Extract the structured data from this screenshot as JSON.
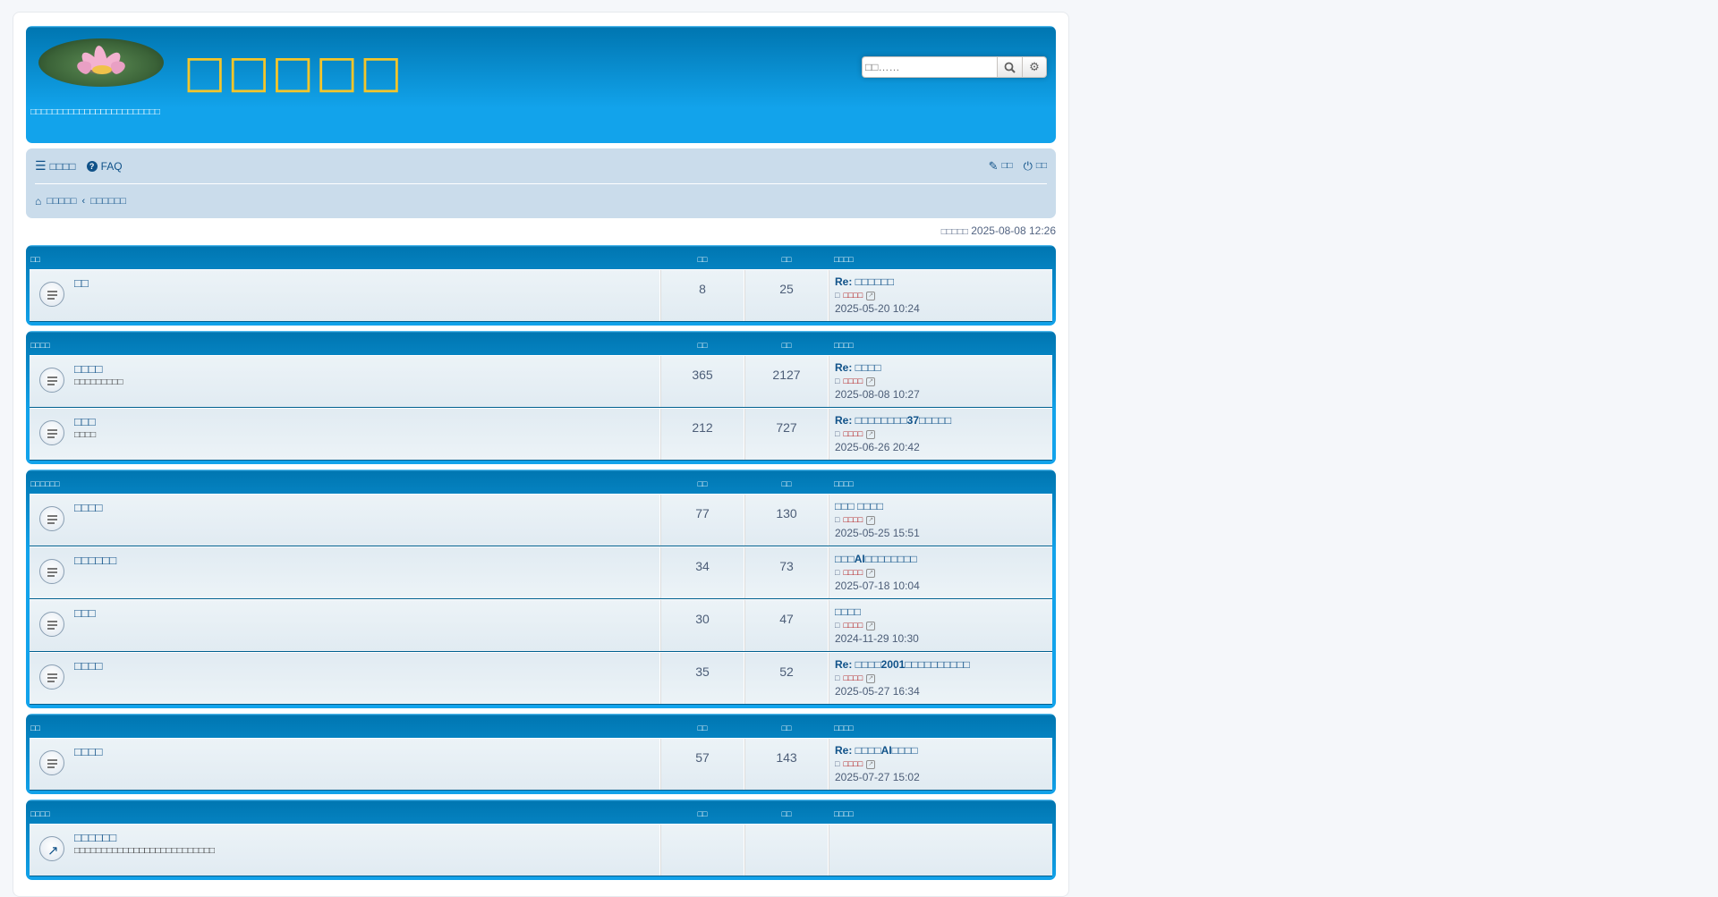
{
  "header": {
    "site_name": "□□□□□",
    "site_desc": "□□□□□□□□□□□□□□□□□□□□□□□□",
    "search_placeholder": "□□……"
  },
  "nav": {
    "quick_links": "□□□□",
    "faq": "FAQ",
    "register": "□□",
    "login": "□□",
    "crumb_home": "□□□□□",
    "crumb_index": "□□□□□□"
  },
  "time_info": {
    "label": "□□□□□",
    "value": "2025-08-08 12:26"
  },
  "categories": [
    {
      "name": "□□",
      "topics_label": "□□",
      "posts_label": "□□",
      "last_label": "□□□□",
      "forums": [
        {
          "title": "□□",
          "desc": "",
          "topics": "8",
          "posts": "25",
          "last_title": "Re: □□□□□□",
          "by": "□",
          "user": "□□□□",
          "time": "2025-05-20 10:24"
        }
      ]
    },
    {
      "name": "□□□□",
      "topics_label": "□□",
      "posts_label": "□□",
      "last_label": "□□□□",
      "forums": [
        {
          "title": "□□□□",
          "desc": "□□□□□□□□□",
          "topics": "365",
          "posts": "2127",
          "last_title": "Re: □□□□",
          "by": "□",
          "user": "□□□□",
          "time": "2025-08-08 10:27"
        },
        {
          "title": "□□□",
          "desc": "□□□□",
          "topics": "212",
          "posts": "727",
          "last_title": "Re: □□□□□□□□37□□□□□",
          "by": "□",
          "user": "□□□□",
          "time": "2025-06-26 20:42"
        }
      ]
    },
    {
      "name": "□□□□□□",
      "topics_label": "□□",
      "posts_label": "□□",
      "last_label": "□□□□",
      "forums": [
        {
          "title": "□□□□",
          "desc": "",
          "topics": "77",
          "posts": "130",
          "last_title": "□□□ □□□□",
          "by": "□",
          "user": "□□□□",
          "time": "2025-05-25 15:51"
        },
        {
          "title": "□□□□□□",
          "desc": "",
          "topics": "34",
          "posts": "73",
          "last_title": "□□□AI□□□□□□□□",
          "by": "□",
          "user": "□□□□",
          "time": "2025-07-18 10:04"
        },
        {
          "title": "□□□",
          "desc": "",
          "topics": "30",
          "posts": "47",
          "last_title": "□□□□",
          "by": "□",
          "user": "□□□□",
          "time": "2024-11-29 10:30"
        },
        {
          "title": "□□□□",
          "desc": "",
          "topics": "35",
          "posts": "52",
          "last_title": "Re: □□□□2001□□□□□□□□□□",
          "by": "□",
          "user": "□□□□",
          "time": "2025-05-27 16:34"
        }
      ]
    },
    {
      "name": "□□",
      "topics_label": "□□",
      "posts_label": "□□",
      "last_label": "□□□□",
      "forums": [
        {
          "title": "□□□□",
          "desc": "",
          "topics": "57",
          "posts": "143",
          "last_title": "Re: □□□□AI□□□□",
          "by": "□",
          "user": "□□□□",
          "time": "2025-07-27 15:02"
        }
      ]
    },
    {
      "name": "□□□□",
      "topics_label": "□□",
      "posts_label": "□□",
      "last_label": "□□□□",
      "forums": [
        {
          "title": "□□□□□□",
          "desc": "□□□□□□□□□□□□□□□□□□□□□□□□□□",
          "topics": "",
          "posts": "",
          "last_title": "",
          "by": "",
          "user": "",
          "time": "",
          "link": true
        }
      ]
    }
  ]
}
